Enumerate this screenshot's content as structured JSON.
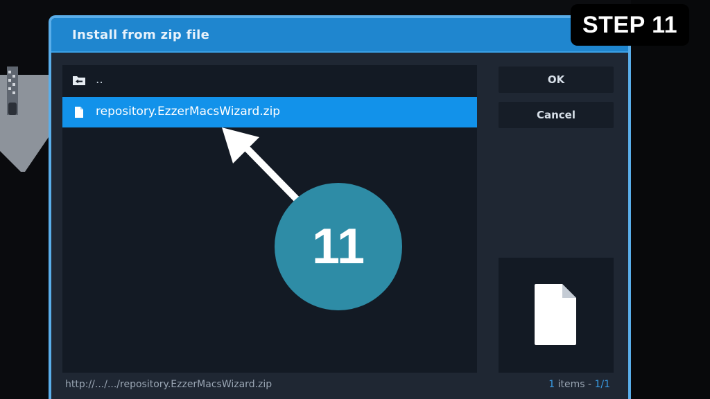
{
  "dialog": {
    "title": "Install from zip file",
    "items": [
      {
        "label": "..",
        "icon": "folder-back-icon",
        "selected": false
      },
      {
        "label": "repository.EzzerMacsWizard.zip",
        "icon": "file-icon",
        "selected": true
      }
    ],
    "buttons": {
      "ok": "OK",
      "cancel": "Cancel"
    },
    "status": {
      "path": "http://.../.../repository.EzzerMacsWizard.zip",
      "count": "1",
      "count_suffix": " items - ",
      "page": "1/1"
    }
  },
  "overlay": {
    "step_label": "STEP 11",
    "step_number": "11"
  },
  "colors": {
    "accent": "#1292ea",
    "titlebar": "#1f86cf",
    "annotation": "#2e8ca6"
  }
}
